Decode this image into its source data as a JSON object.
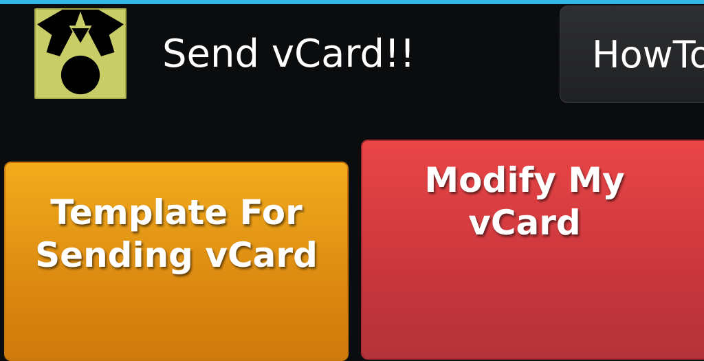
{
  "app": {
    "title": "Send vCard!!",
    "icon": "tuxedo-bowtie-icon"
  },
  "header": {
    "howto_label": "HowTo"
  },
  "tiles": [
    {
      "label_lines": [
        "Template For",
        "Sending vCard"
      ],
      "color": "#f0a51b"
    },
    {
      "label_lines": [
        "Modify My vCard"
      ],
      "color": "#e84446"
    }
  ],
  "colors": {
    "status_strip": "#33b5e5",
    "background": "#0b0c0e",
    "icon_bg": "#c9cd67"
  }
}
